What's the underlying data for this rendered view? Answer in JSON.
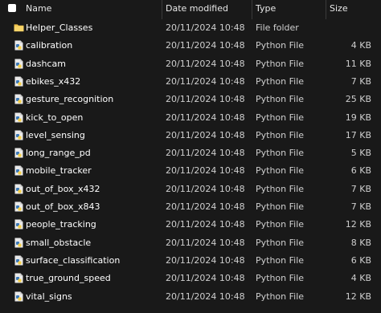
{
  "header": {
    "name": "Name",
    "date_modified": "Date modified",
    "type": "Type",
    "size": "Size"
  },
  "rows": [
    {
      "name": "Helper_Classes",
      "date": "20/11/2024 10:48",
      "type": "File folder",
      "size": "",
      "icon": "folder-icon"
    },
    {
      "name": "calibration",
      "date": "20/11/2024 10:48",
      "type": "Python File",
      "size": "4 KB",
      "icon": "python-file-icon"
    },
    {
      "name": "dashcam",
      "date": "20/11/2024 10:48",
      "type": "Python File",
      "size": "11 KB",
      "icon": "python-file-icon"
    },
    {
      "name": "ebikes_x432",
      "date": "20/11/2024 10:48",
      "type": "Python File",
      "size": "7 KB",
      "icon": "python-file-icon"
    },
    {
      "name": "gesture_recognition",
      "date": "20/11/2024 10:48",
      "type": "Python File",
      "size": "25 KB",
      "icon": "python-file-icon"
    },
    {
      "name": "kick_to_open",
      "date": "20/11/2024 10:48",
      "type": "Python File",
      "size": "19 KB",
      "icon": "python-file-icon"
    },
    {
      "name": "level_sensing",
      "date": "20/11/2024 10:48",
      "type": "Python File",
      "size": "17 KB",
      "icon": "python-file-icon"
    },
    {
      "name": "long_range_pd",
      "date": "20/11/2024 10:48",
      "type": "Python File",
      "size": "5 KB",
      "icon": "python-file-icon"
    },
    {
      "name": "mobile_tracker",
      "date": "20/11/2024 10:48",
      "type": "Python File",
      "size": "6 KB",
      "icon": "python-file-icon"
    },
    {
      "name": "out_of_box_x432",
      "date": "20/11/2024 10:48",
      "type": "Python File",
      "size": "7 KB",
      "icon": "python-file-icon"
    },
    {
      "name": "out_of_box_x843",
      "date": "20/11/2024 10:48",
      "type": "Python File",
      "size": "7 KB",
      "icon": "python-file-icon"
    },
    {
      "name": "people_tracking",
      "date": "20/11/2024 10:48",
      "type": "Python File",
      "size": "12 KB",
      "icon": "python-file-icon"
    },
    {
      "name": "small_obstacle",
      "date": "20/11/2024 10:48",
      "type": "Python File",
      "size": "8 KB",
      "icon": "python-file-icon"
    },
    {
      "name": "surface_classification",
      "date": "20/11/2024 10:48",
      "type": "Python File",
      "size": "6 KB",
      "icon": "python-file-icon"
    },
    {
      "name": "true_ground_speed",
      "date": "20/11/2024 10:48",
      "type": "Python File",
      "size": "4 KB",
      "icon": "python-file-icon"
    },
    {
      "name": "vital_signs",
      "date": "20/11/2024 10:48",
      "type": "Python File",
      "size": "12 KB",
      "icon": "python-file-icon"
    }
  ],
  "colors": {
    "background": "#191919",
    "folder": "#f0c24b",
    "python_blue": "#3a78b8",
    "python_yellow": "#f6cf45"
  }
}
